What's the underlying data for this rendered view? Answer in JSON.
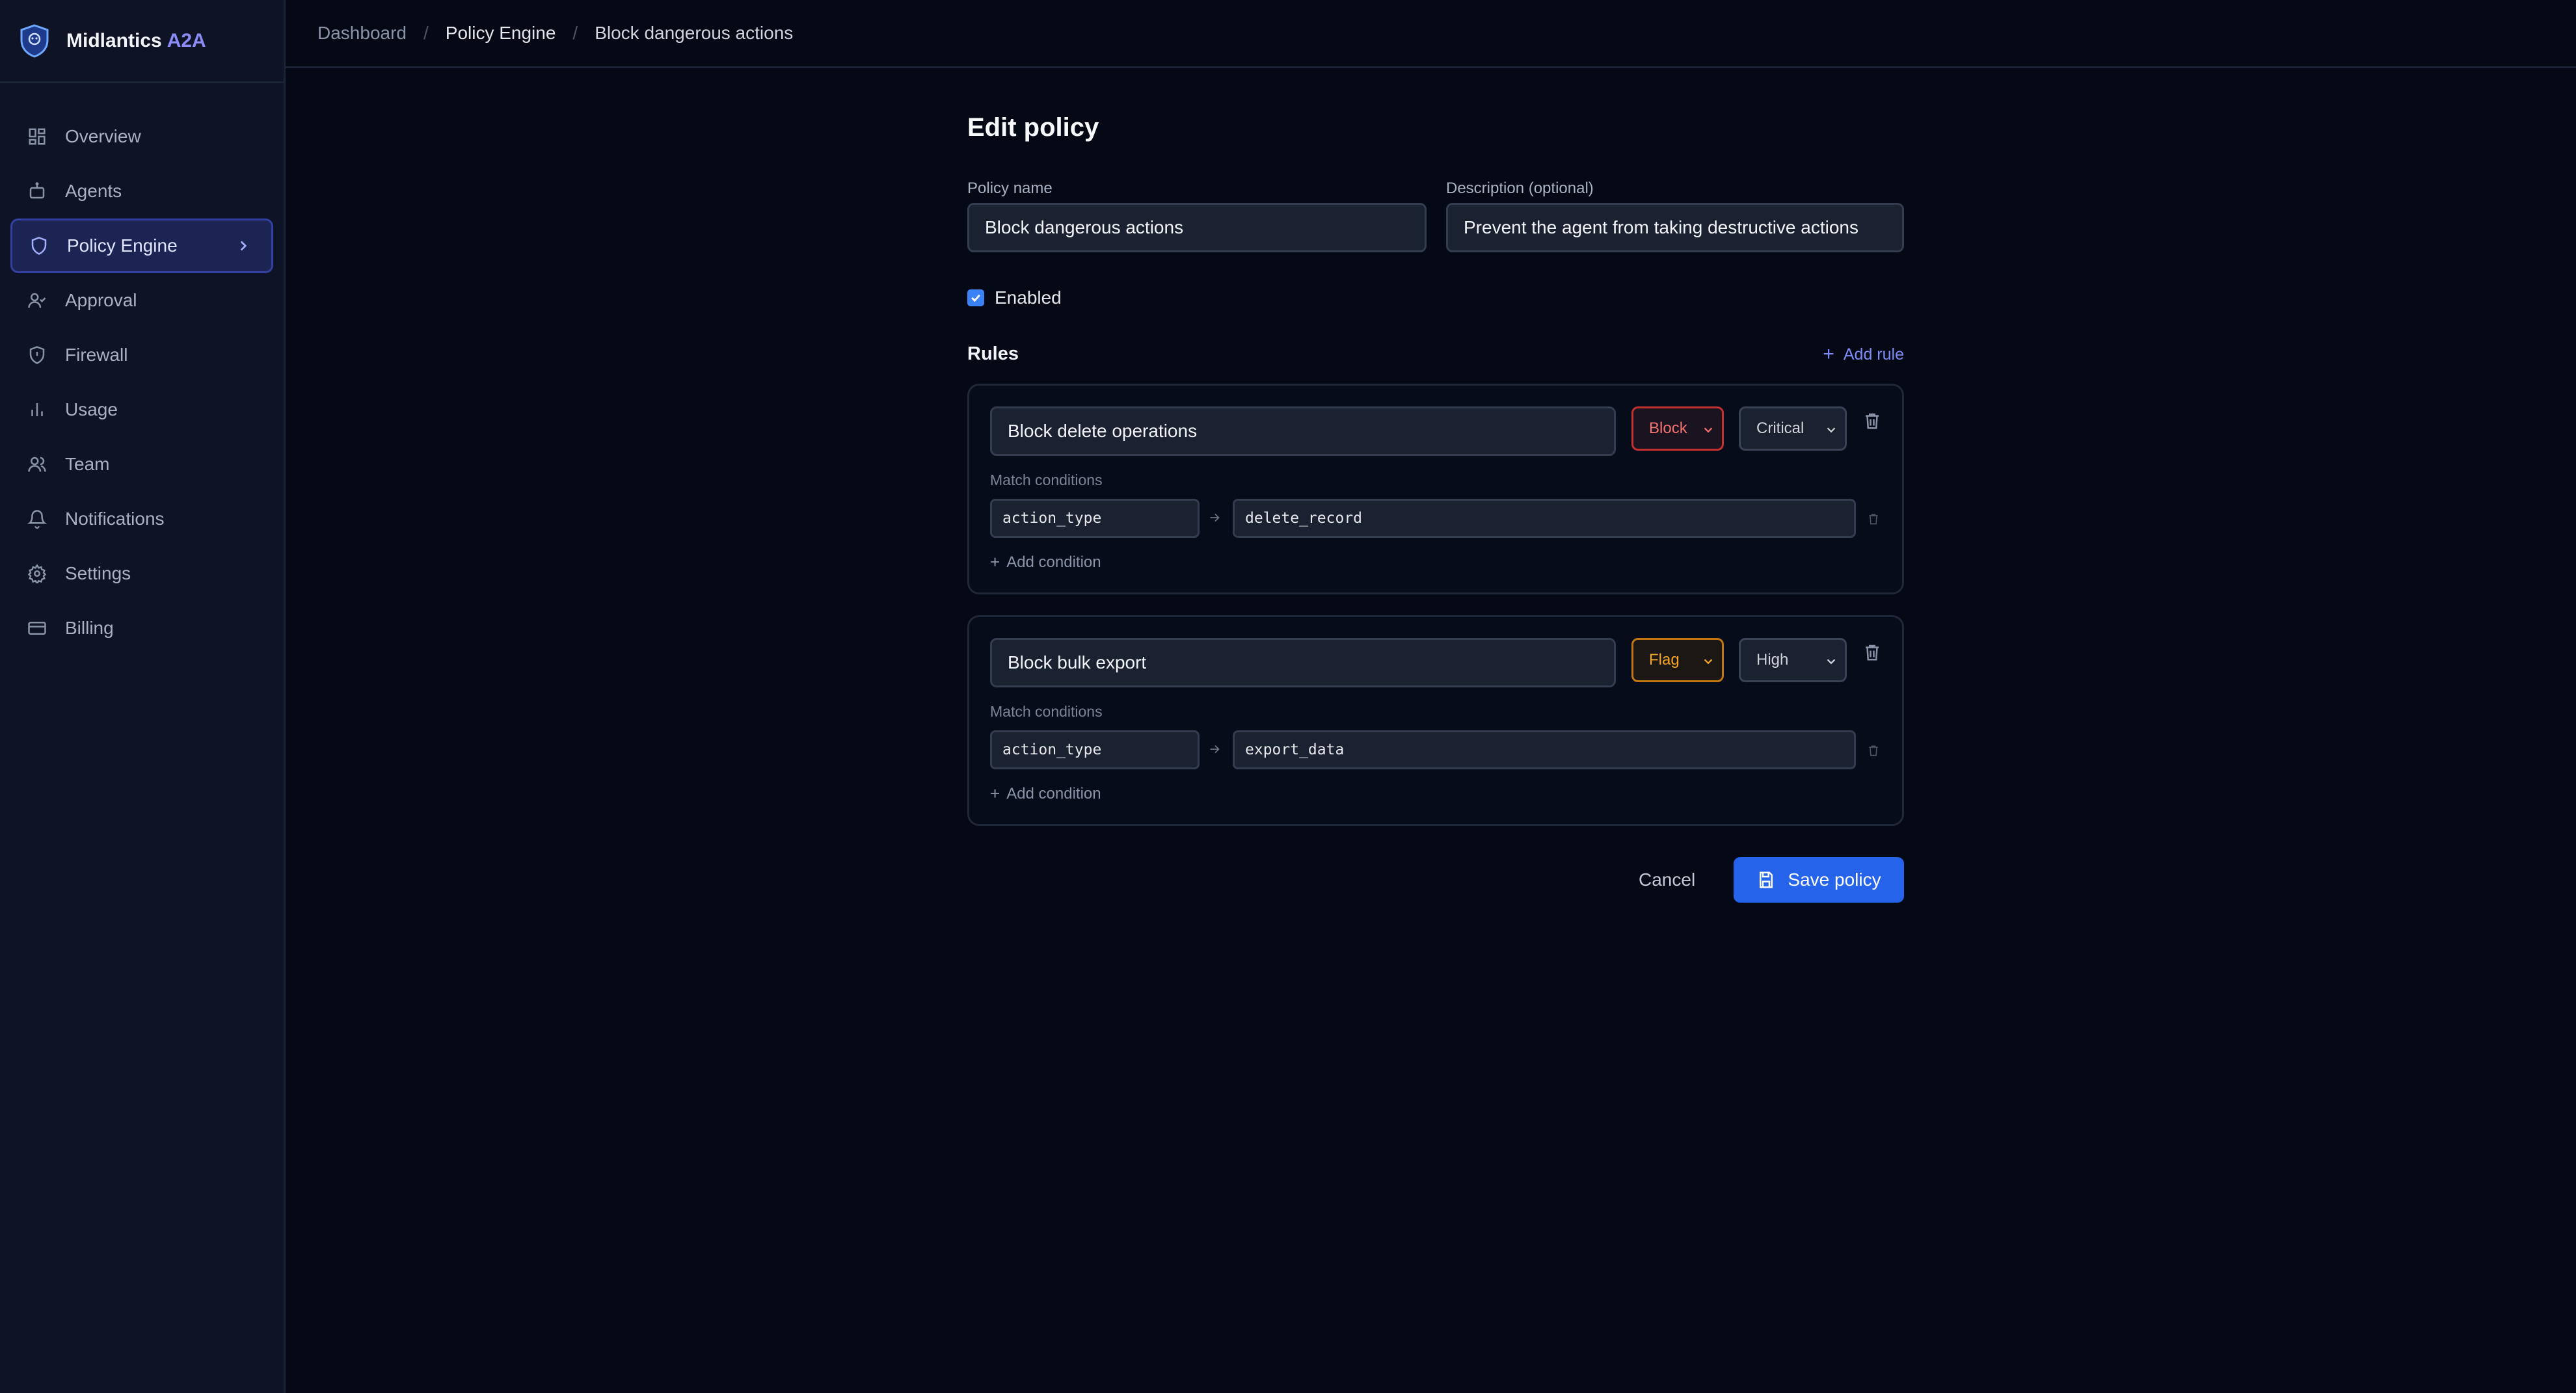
{
  "app": {
    "name": "Midlantics",
    "name_accent": "A2A"
  },
  "sidebar": {
    "items": [
      {
        "label": "Overview",
        "icon": "grid-icon"
      },
      {
        "label": "Agents",
        "icon": "bot-icon"
      },
      {
        "label": "Policy Engine",
        "icon": "shield-icon",
        "active": true
      },
      {
        "label": "Approval",
        "icon": "user-check-icon"
      },
      {
        "label": "Firewall",
        "icon": "shield-icon"
      },
      {
        "label": "Usage",
        "icon": "bar-chart-icon"
      },
      {
        "label": "Team",
        "icon": "users-icon"
      },
      {
        "label": "Notifications",
        "icon": "bell-icon"
      },
      {
        "label": "Settings",
        "icon": "gear-icon"
      },
      {
        "label": "Billing",
        "icon": "credit-card-icon"
      }
    ]
  },
  "breadcrumb": {
    "items": [
      "Dashboard",
      "Policy Engine",
      "Block dangerous actions"
    ],
    "separator": "/"
  },
  "form": {
    "title": "Edit policy",
    "policy_name_label": "Policy name",
    "policy_name_value": "Block dangerous actions",
    "description_label": "Description (optional)",
    "description_value": "Prevent the agent from taking destructive actions",
    "enabled_label": "Enabled",
    "enabled": true,
    "rules_heading": "Rules",
    "add_rule_label": "Add rule"
  },
  "rules": [
    {
      "name": "Block delete operations",
      "action": "Block",
      "severity": "Critical",
      "match_conditions_label": "Match conditions",
      "condition_key": "action_type",
      "condition_value": "delete_record",
      "add_condition_label": "Add condition"
    },
    {
      "name": "Block bulk export",
      "action": "Flag",
      "severity": "High",
      "match_conditions_label": "Match conditions",
      "condition_key": "action_type",
      "condition_value": "export_data",
      "add_condition_label": "Add condition"
    }
  ],
  "actions": {
    "cancel_label": "Cancel",
    "save_label": "Save policy"
  },
  "colors": {
    "accent": "#2563eb",
    "active_nav_bg": "#1b2453",
    "block": "#f87171",
    "flag": "#f5a524",
    "background": "#050916"
  }
}
